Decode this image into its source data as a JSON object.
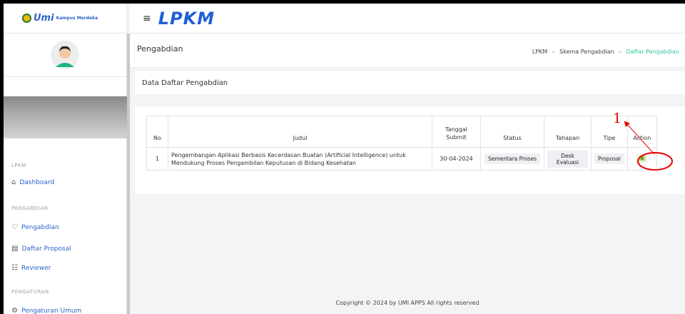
{
  "sidebar": {
    "logo_text": "Umi",
    "logo_badge": "Kampus Merdeka",
    "sections": [
      {
        "label": "LPKM"
      },
      {
        "label": "PENGABDIAN"
      },
      {
        "label": "PENGATURAN"
      }
    ],
    "items": [
      {
        "label": "Dashboard",
        "icon": "home-icon"
      },
      {
        "label": "Pengabdian",
        "icon": "heart-hand-icon"
      },
      {
        "label": "Daftar Proposal",
        "icon": "document-icon"
      },
      {
        "label": "Reviewer",
        "icon": "review-icon"
      },
      {
        "label": "Pengaturan Umum",
        "icon": "gear-icon"
      }
    ]
  },
  "topbar": {
    "brand": "LPKM",
    "menu_icon": "hamburger-icon"
  },
  "header": {
    "title": "Pengabdian",
    "breadcrumb": [
      "LPKM",
      "Skema Pengabdian",
      "Daftar Pengabdian"
    ]
  },
  "card": {
    "title": "Data Daftar Pengabdian"
  },
  "table": {
    "columns": [
      "No",
      "Judul",
      "Tanggal Submit",
      "Status",
      "Tahapan",
      "Tipe",
      "Action"
    ],
    "rows": [
      {
        "no": "1",
        "judul": "Pengembangan Aplikasi Berbasis Kecerdasan Buatan (Artificial Intelligence) untuk Mendukung Proses Pengambilan Keputusan di Bidang Kesehatan",
        "tanggal": "30-04-2024",
        "status": "Sementara Proses",
        "tahapan": "Desk Evaluasi",
        "tipe": "Proposal",
        "action_icon": "document-icon"
      }
    ]
  },
  "footer": {
    "text": "Copyright © 2024 by UMI APPS All rights reserved"
  },
  "annotation": {
    "number": "1",
    "color": "#e00000"
  }
}
